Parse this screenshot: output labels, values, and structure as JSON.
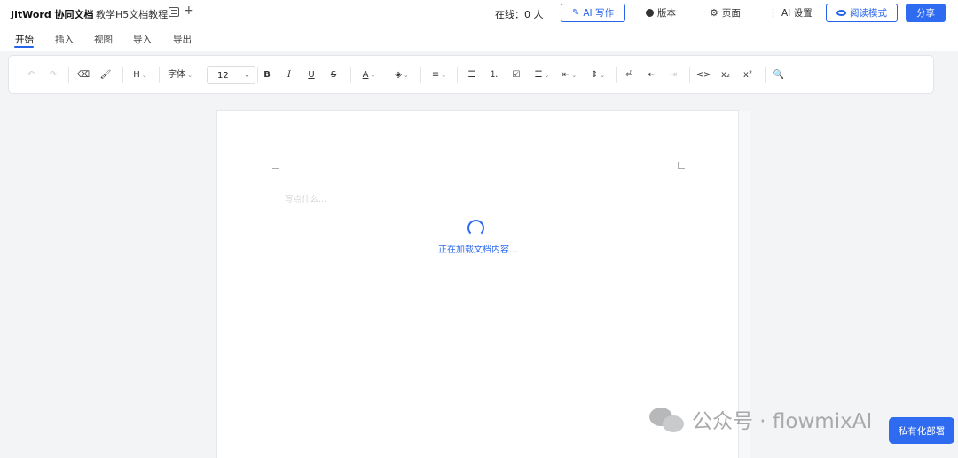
{
  "app": {
    "title": "JitWord 协同文档",
    "doc_title": "教学H5文档教程",
    "add_tab": "+"
  },
  "header": {
    "online_label": "在线：0 人",
    "ai_write": "AI 写作",
    "version": "版本",
    "page": "页面",
    "ai_settings": "AI 设置",
    "read_mode": "阅读模式",
    "share": "分享"
  },
  "menu": {
    "tabs": [
      {
        "label": "开始",
        "active": true
      },
      {
        "label": "插入",
        "active": false
      },
      {
        "label": "视图",
        "active": false
      },
      {
        "label": "导入",
        "active": false
      },
      {
        "label": "导出",
        "active": false
      }
    ]
  },
  "toolbar": {
    "undo": "↶",
    "redo": "↷",
    "eraser": "⌫",
    "format_painter": "🖌",
    "heading": "H",
    "font_family": "字体",
    "font_size": "12",
    "bold": "B",
    "italic": "I",
    "underline": "U",
    "strike": "S",
    "text_color": "A",
    "highlight": "◈",
    "align": "≡",
    "bullet_list": "☰",
    "ordered_list": "⒈",
    "task_list": "☑",
    "line_height": "☰",
    "indent_menu": "⇤",
    "spacing": "⇕",
    "wrap": "⏎",
    "outdent": "⇤",
    "indent": "⇥",
    "code": "<>",
    "subscript": "x₂",
    "superscript": "x²",
    "search": "🔍"
  },
  "editor": {
    "placeholder": "写点什么...",
    "loading": "正在加载文档内容..."
  },
  "watermark": {
    "text": "公众号 · flowmixAI"
  },
  "private_deploy": "私有化部署",
  "colors": {
    "accent": "#2f6bf0",
    "outline_accent": "#2563eb",
    "page_bg": "#f3f4f6"
  }
}
